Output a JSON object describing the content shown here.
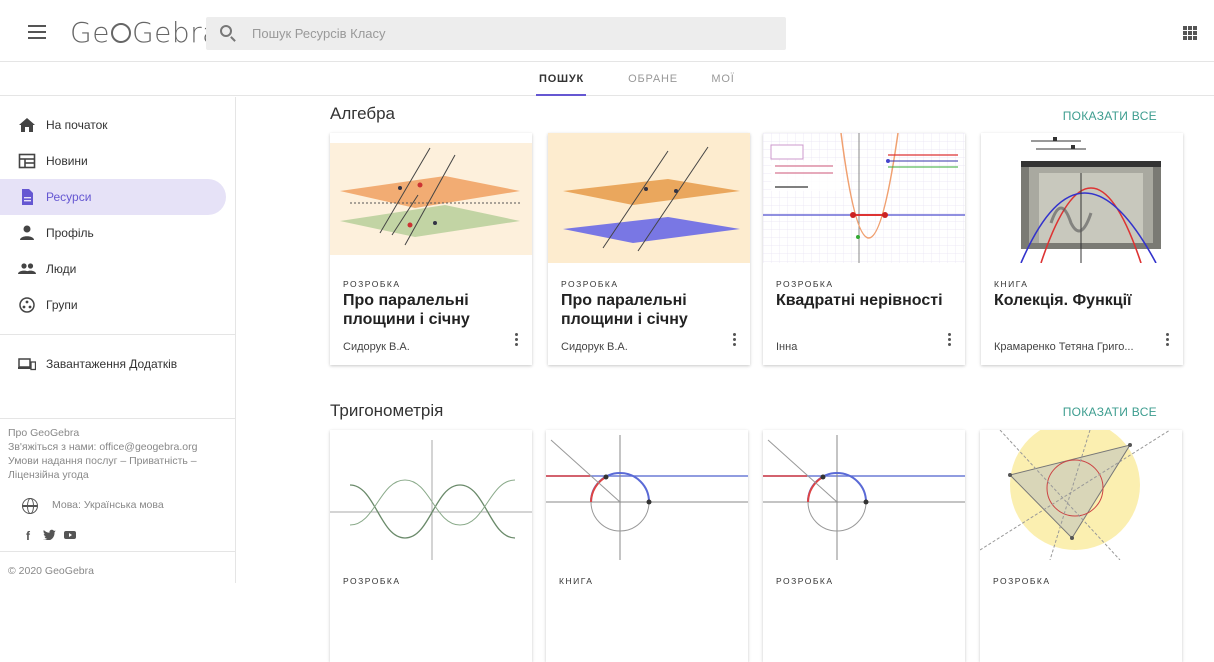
{
  "header": {
    "logo_text": "GeoGebra",
    "search_placeholder": "Пошук Ресурсів Класу"
  },
  "tabs": [
    {
      "label": "ПОШУК",
      "active": true
    },
    {
      "label": "ОБРАНЕ",
      "active": false
    },
    {
      "label": "МОЇ",
      "active": false
    }
  ],
  "sidebar": {
    "items": [
      {
        "label": "На початок",
        "icon": "home-icon"
      },
      {
        "label": "Новини",
        "icon": "news-icon"
      },
      {
        "label": "Ресурси",
        "icon": "document-icon",
        "active": true
      },
      {
        "label": "Профіль",
        "icon": "person-icon"
      },
      {
        "label": "Люди",
        "icon": "people-icon"
      },
      {
        "label": "Групи",
        "icon": "groups-icon"
      }
    ],
    "download_label": "Завантаження Додатків",
    "footer": {
      "about": "Про GeoGebra",
      "contact": "Зв'яжіться з нами: office@geogebra.org",
      "terms_line1": "Умови надання послуг – Приватність –",
      "terms_line2": "Ліцензійна угода",
      "language": "Мова: Українська мова",
      "copyright": "© 2020 GeoGebra"
    }
  },
  "sections": [
    {
      "title": "Алгебра",
      "show_all": "ПОКАЗАТИ ВСЕ",
      "cards": [
        {
          "type": "РОЗРОБКА",
          "title": "Про паралельні площини і січну",
          "author": "Сидорук В.А."
        },
        {
          "type": "РОЗРОБКА",
          "title": "Про паралельні площини і січну",
          "author": "Сидорук В.А."
        },
        {
          "type": "РОЗРОБКА",
          "title": "Квадратні нерівності",
          "author": "Інна"
        },
        {
          "type": "КНИГА",
          "title": "Колекція. Функції",
          "author": "Крамаренко Тетяна Григо..."
        }
      ]
    },
    {
      "title": "Тригонометрія",
      "show_all": "ПОКАЗАТИ ВСЕ",
      "cards": [
        {
          "type": "РОЗРОБКА"
        },
        {
          "type": "КНИГА"
        },
        {
          "type": "РОЗРОБКА"
        },
        {
          "type": "РОЗРОБКА"
        }
      ]
    }
  ],
  "colors": {
    "accent": "#6557d2",
    "link": "#3d9d8f",
    "active_bg": "#e6e2f7"
  }
}
